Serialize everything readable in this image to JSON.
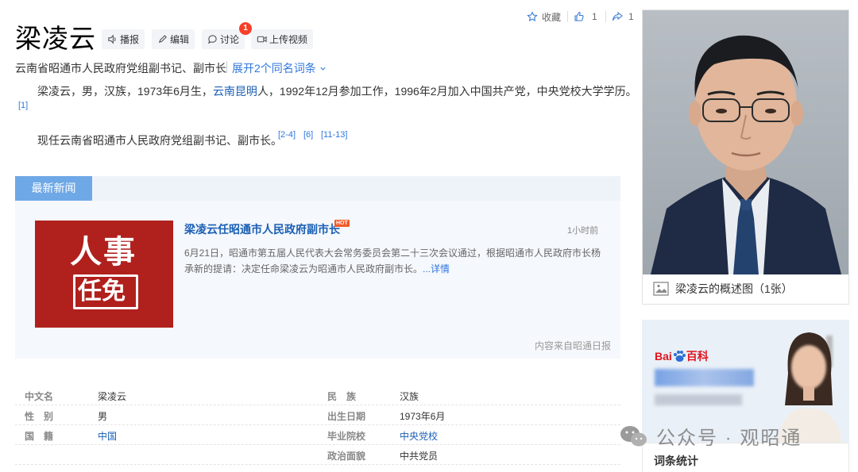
{
  "header": {
    "title": "梁凌云",
    "buttons": {
      "broadcast": "播报",
      "edit": "编辑",
      "discuss": "讨论",
      "upload_video": "上传视频"
    },
    "discuss_badge": "1",
    "subtitle": "云南省昭通市人民政府党组副书记、副市长",
    "expand_label": "展开2个同名词条"
  },
  "top_actions": {
    "favorite": "收藏",
    "like_count": "1",
    "share_count": "1"
  },
  "summary": {
    "p1_part1": "梁凌云，男，汉族，1973年6月生，",
    "p1_link": "云南昆明",
    "p1_part2": "人，1992年12月参加工作，1996年2月加入中国共产党，中央党校大学学历。",
    "p1_ref": "[1]",
    "p2": "现任云南省昭通市人民政府党组副书记、副市长。",
    "p2_refs": [
      "[2-4]",
      "[6]",
      "[11-13]"
    ]
  },
  "news": {
    "tab_label": "最新新闻",
    "image_text_top": "人事",
    "image_text_bottom": "任免",
    "title": "梁凌云任昭通市人民政府副市长",
    "hot_badge": "HOT",
    "time": "1小时前",
    "body": "6月21日，昭通市第五届人民代表大会常务委员会第二十三次会议通过，根据昭通市人民政府市长杨承新的提请：决定任命梁凌云为昭通市人民政府副市长。",
    "more": "...详情",
    "source": "内容来自昭通日报"
  },
  "info": {
    "rows": [
      {
        "l1": "中文名",
        "v1": "梁凌云",
        "l2": "民　族",
        "v2": "汉族"
      },
      {
        "l1": "性　别",
        "v1": "男",
        "l2": "出生日期",
        "v2": "1973年6月"
      },
      {
        "l1": "国　籍",
        "v1": "中国",
        "l2": "毕业院校",
        "v2": "中央党校"
      },
      {
        "l1": "",
        "v1": "",
        "l2": "政治面貌",
        "v2": "中共党员"
      }
    ]
  },
  "sidebar": {
    "photo_caption": "梁凌云的概述图（1张）",
    "ad_logo_text": "Bai",
    "ad_logo_text2": "百科",
    "stats_label": "词条统计"
  },
  "watermark": "公众号 · 观昭通",
  "colors": {
    "link": "#1a5fb4",
    "accent": "#2f77dd",
    "news_tab": "#6fa8e6",
    "badge": "#f6402a",
    "news_image": "#b0201c"
  }
}
